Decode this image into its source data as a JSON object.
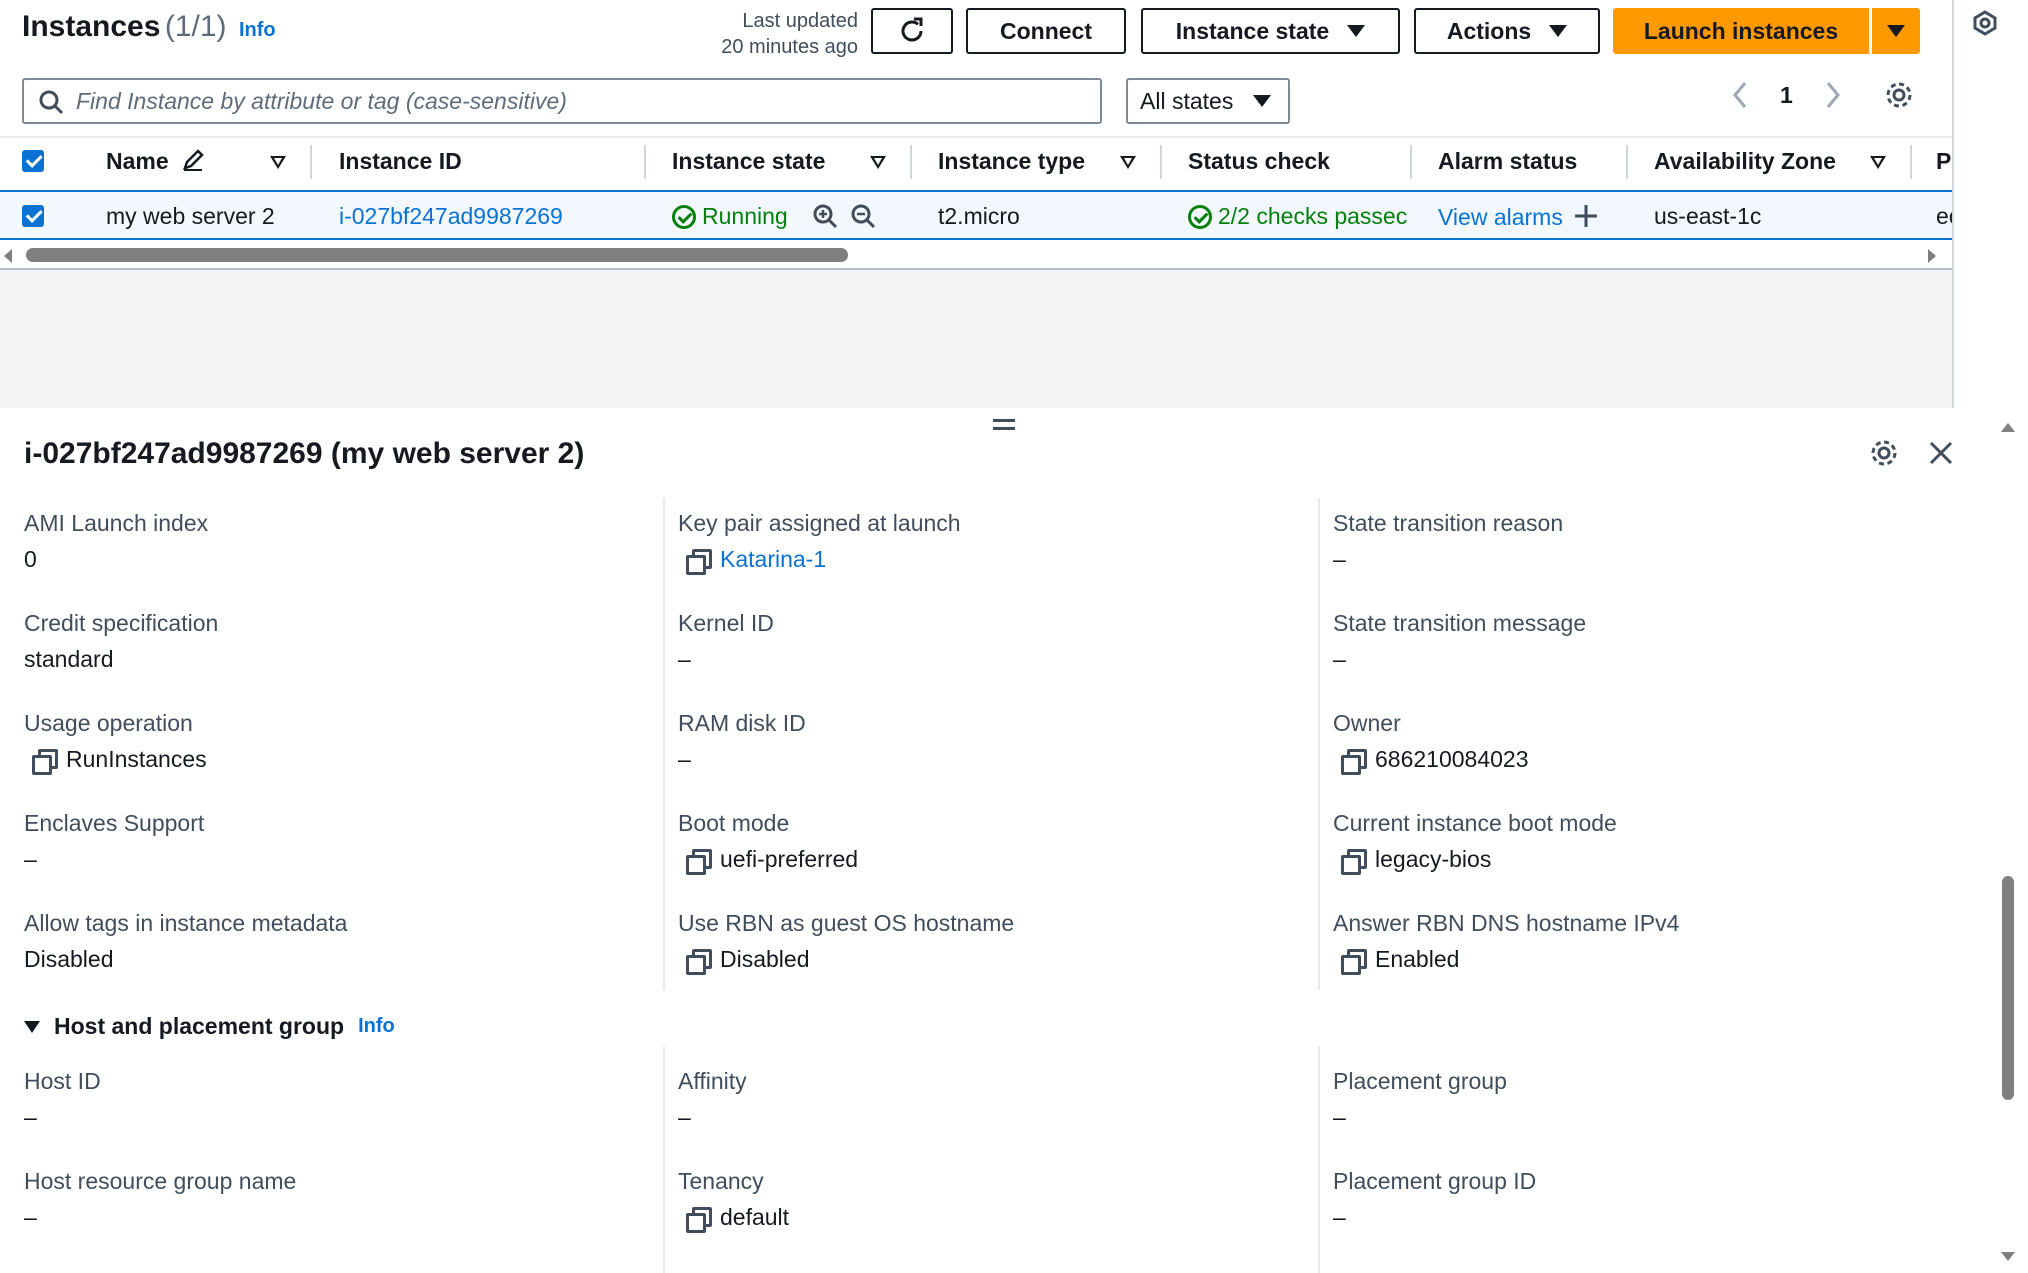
{
  "header": {
    "title": "Instances",
    "count": "(1/1)",
    "info": "Info",
    "last_updated_line1": "Last updated",
    "last_updated_line2": "20 minutes ago"
  },
  "toolbar": {
    "connect": "Connect",
    "instance_state": "Instance state",
    "actions": "Actions",
    "launch": "Launch instances"
  },
  "search": {
    "placeholder": "Find Instance by attribute or tag (case-sensitive)",
    "states_filter": "All states"
  },
  "pagination": {
    "page": "1"
  },
  "table": {
    "columns": [
      "Name",
      "Instance ID",
      "Instance state",
      "Instance type",
      "Status check",
      "Alarm status",
      "Availability Zone",
      "P"
    ],
    "row": {
      "name": "my web server 2",
      "instance_id": "i-027bf247ad9987269",
      "state": "Running",
      "type": "t2.micro",
      "status_check": "2/2 checks passec",
      "alarm": "View alarms",
      "az": "us-east-1c",
      "extra": "ec"
    }
  },
  "details": {
    "title": "i-027bf247ad9987269 (my web server 2)",
    "fields": [
      {
        "label": "AMI Launch index",
        "value": "0"
      },
      {
        "label": "Key pair assigned at launch",
        "value": "Katarina-1"
      },
      {
        "label": "State transition reason",
        "value": "–"
      },
      {
        "label": "Credit specification",
        "value": "standard"
      },
      {
        "label": "Kernel ID",
        "value": "–"
      },
      {
        "label": "State transition message",
        "value": "–"
      },
      {
        "label": "Usage operation",
        "value": "RunInstances"
      },
      {
        "label": "RAM disk ID",
        "value": "–"
      },
      {
        "label": "Owner",
        "value": "686210084023"
      },
      {
        "label": "Enclaves Support",
        "value": "–"
      },
      {
        "label": "Boot mode",
        "value": "uefi-preferred"
      },
      {
        "label": "Current instance boot mode",
        "value": "legacy-bios"
      },
      {
        "label": "Allow tags in instance metadata",
        "value": "Disabled"
      },
      {
        "label": "Use RBN as guest OS hostname",
        "value": "Disabled"
      },
      {
        "label": "Answer RBN DNS hostname IPv4",
        "value": "Enabled"
      }
    ],
    "host_section": {
      "title": "Host and placement group",
      "info": "Info",
      "fields": [
        {
          "label": "Host ID",
          "value": "–"
        },
        {
          "label": "Affinity",
          "value": "–"
        },
        {
          "label": "Placement group",
          "value": "–"
        },
        {
          "label": "Host resource group name",
          "value": "–"
        },
        {
          "label": "Tenancy",
          "value": "default"
        },
        {
          "label": "Placement group ID",
          "value": "–"
        }
      ]
    }
  },
  "colors": {
    "primary": "#ff9900",
    "link": "#0972d3",
    "success": "#037f0c"
  }
}
